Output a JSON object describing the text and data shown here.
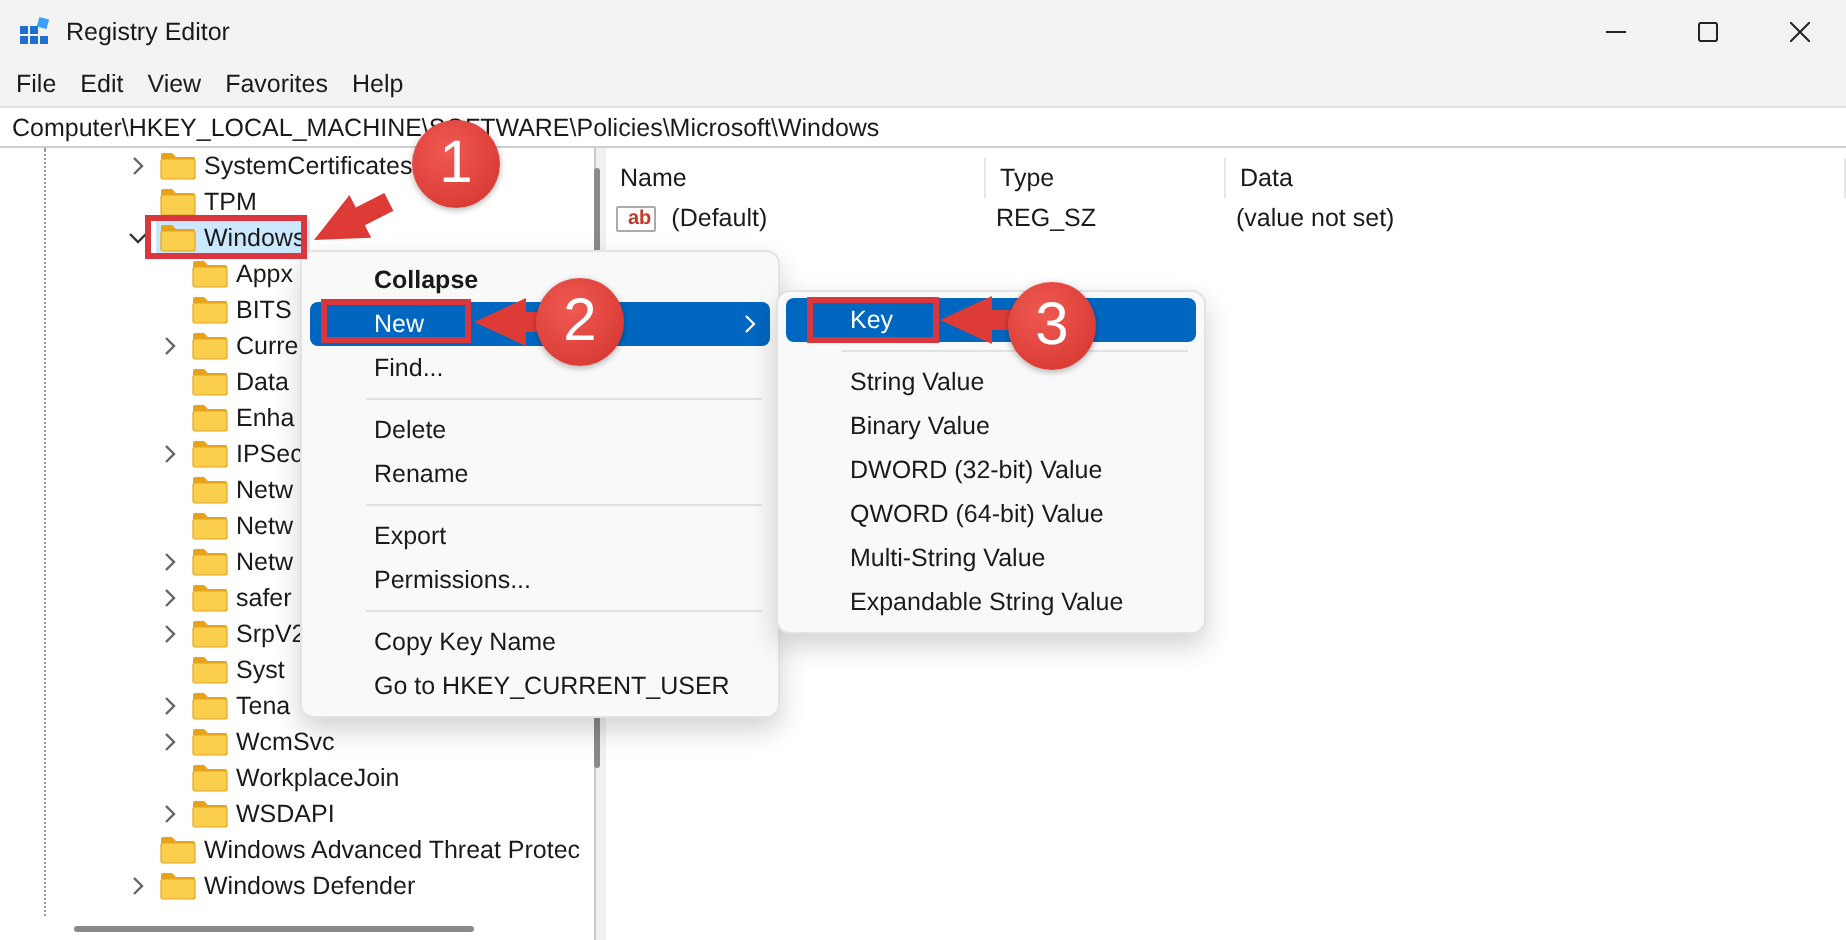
{
  "window": {
    "title": "Registry Editor"
  },
  "menu_bar": [
    "File",
    "Edit",
    "View",
    "Favorites",
    "Help"
  ],
  "address_bar": {
    "value": "Computer\\HKEY_LOCAL_MACHINE\\SOFTWARE\\Policies\\Microsoft\\Windows"
  },
  "tree": [
    {
      "label": "SystemCertificates",
      "expandable": true,
      "expanded": false,
      "selected": false
    },
    {
      "label": "TPM",
      "expandable": false,
      "selected": false
    },
    {
      "label": "Windows",
      "expandable": true,
      "expanded": true,
      "selected": true,
      "children": [
        {
          "label": "Appx",
          "expandable": false,
          "selected": false
        },
        {
          "label": "BITS",
          "expandable": false,
          "selected": false
        },
        {
          "label": "Curre",
          "expandable": true,
          "expanded": false,
          "selected": false
        },
        {
          "label": "Data",
          "expandable": false,
          "selected": false
        },
        {
          "label": "Enha",
          "expandable": false,
          "selected": false
        },
        {
          "label": "IPSec",
          "expandable": true,
          "expanded": false,
          "selected": false
        },
        {
          "label": "Netw",
          "expandable": false,
          "selected": false
        },
        {
          "label": "Netw",
          "expandable": false,
          "selected": false
        },
        {
          "label": "Netw",
          "expandable": true,
          "expanded": false,
          "selected": false
        },
        {
          "label": "safer",
          "expandable": true,
          "expanded": false,
          "selected": false
        },
        {
          "label": "SrpV2",
          "expandable": true,
          "expanded": false,
          "selected": false
        },
        {
          "label": "Syst",
          "expandable": false,
          "selected": false
        },
        {
          "label": "Tena",
          "expandable": true,
          "expanded": false,
          "selected": false
        },
        {
          "label": "WcmSvc",
          "expandable": true,
          "expanded": false,
          "selected": false
        },
        {
          "label": "WorkplaceJoin",
          "expandable": false,
          "selected": false
        },
        {
          "label": "WSDAPI",
          "expandable": true,
          "expanded": false,
          "selected": false
        }
      ]
    },
    {
      "label": "Windows Advanced Threat Protec",
      "expandable": false,
      "selected": false
    },
    {
      "label": "Windows Defender",
      "expandable": true,
      "expanded": false,
      "selected": false
    }
  ],
  "list": {
    "columns": [
      "Name",
      "Type",
      "Data"
    ],
    "rows": [
      {
        "icon_label": "ab",
        "name": "(Default)",
        "type": "REG_SZ",
        "data": "(value not set)"
      }
    ]
  },
  "context_menu": {
    "items": [
      {
        "kind": "item",
        "label": "Collapse",
        "default": true,
        "selected": false
      },
      {
        "kind": "submenu",
        "label": "New",
        "default": false,
        "selected": true
      },
      {
        "kind": "item",
        "label": "Find...",
        "default": false,
        "selected": false
      },
      {
        "kind": "separator"
      },
      {
        "kind": "item",
        "label": "Delete",
        "default": false,
        "selected": false
      },
      {
        "kind": "item",
        "label": "Rename",
        "default": false,
        "selected": false
      },
      {
        "kind": "separator"
      },
      {
        "kind": "item",
        "label": "Export",
        "default": false,
        "selected": false
      },
      {
        "kind": "item",
        "label": "Permissions...",
        "default": false,
        "selected": false
      },
      {
        "kind": "separator"
      },
      {
        "kind": "item",
        "label": "Copy Key Name",
        "default": false,
        "selected": false
      },
      {
        "kind": "item",
        "label": "Go to HKEY_CURRENT_USER",
        "default": false,
        "selected": false
      }
    ]
  },
  "submenu": {
    "items": [
      {
        "kind": "item",
        "label": "Key",
        "default": false,
        "selected": true
      },
      {
        "kind": "separator"
      },
      {
        "kind": "item",
        "label": "String Value",
        "default": false,
        "selected": false
      },
      {
        "kind": "item",
        "label": "Binary Value",
        "default": false,
        "selected": false
      },
      {
        "kind": "item",
        "label": "DWORD (32-bit) Value",
        "default": false,
        "selected": false
      },
      {
        "kind": "item",
        "label": "QWORD (64-bit) Value",
        "default": false,
        "selected": false
      },
      {
        "kind": "item",
        "label": "Multi-String Value",
        "default": false,
        "selected": false
      },
      {
        "kind": "item",
        "label": "Expandable String Value",
        "default": false,
        "selected": false
      }
    ]
  },
  "annotations": [
    {
      "number": "1"
    },
    {
      "number": "2"
    },
    {
      "number": "3"
    }
  ]
}
